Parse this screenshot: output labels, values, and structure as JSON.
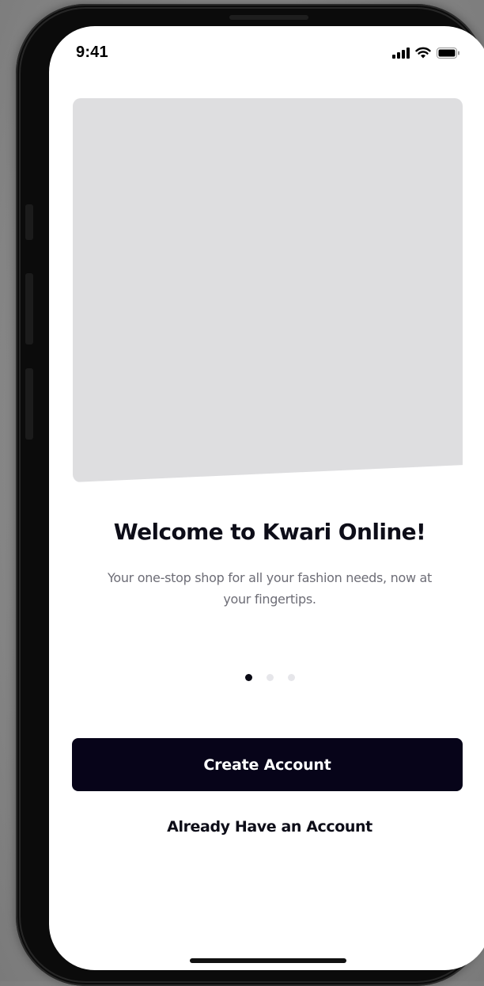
{
  "status_bar": {
    "time": "9:41",
    "icons": [
      "cellular-signal-icon",
      "wifi-icon",
      "battery-icon"
    ]
  },
  "hero": {
    "image": "placeholder"
  },
  "onboarding": {
    "title": "Welcome to Kwari Online!",
    "subtitle": "Your one-stop shop for all your fashion needs, now at your fingertips.",
    "pager": {
      "total": 3,
      "active_index": 0
    }
  },
  "actions": {
    "create_account_label": "Create Account",
    "login_label": "Already Have an Account"
  },
  "colors": {
    "primary": "#070419",
    "placeholder": "#DEDEE0",
    "text_primary": "#0D0D18",
    "text_secondary": "#6D6D76",
    "dot_inactive": "#E6E6EA"
  }
}
